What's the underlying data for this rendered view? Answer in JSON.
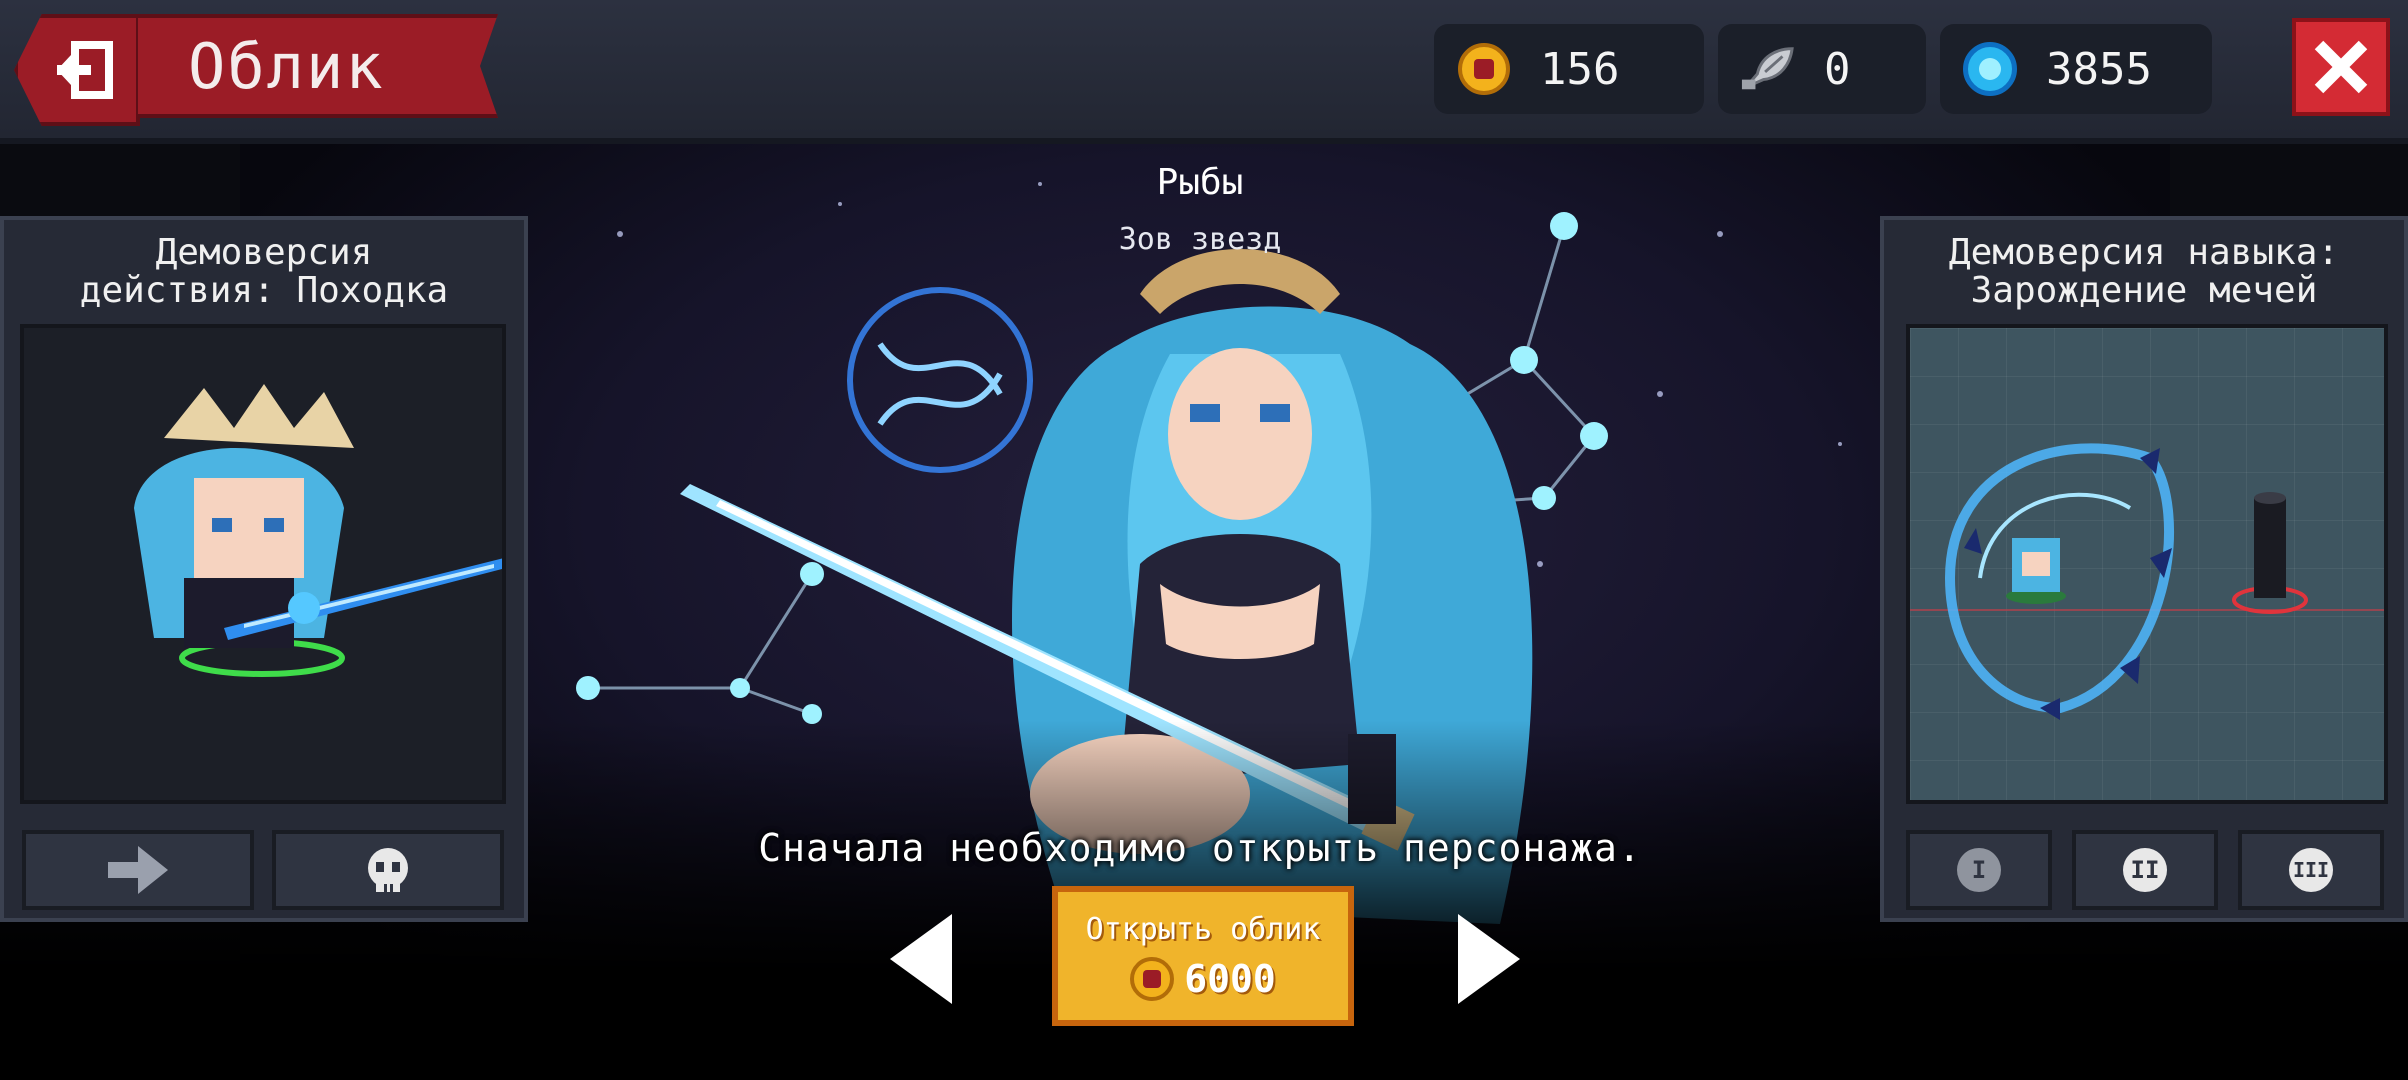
{
  "header": {
    "title": "Облик",
    "back_icon": "exit-door-icon",
    "close_icon": "close-x-icon"
  },
  "currencies": {
    "gold": {
      "icon": "gold-coin-icon",
      "value": "156"
    },
    "fish": {
      "icon": "fish-icon",
      "value": "0"
    },
    "gems": {
      "icon": "blue-gem-icon",
      "value": "3855"
    }
  },
  "character": {
    "name": "Рыбы",
    "skin_name": "Зов звезд"
  },
  "notice": "Сначала необходимо открыть персонажа.",
  "unlock": {
    "label": "Открыть облик",
    "price": "6000",
    "price_icon": "gold-coin-icon"
  },
  "left_panel": {
    "title_line1": "Демоверсия",
    "title_line2": "действия: Походка",
    "buttons": [
      {
        "icon": "arrow-right-icon"
      },
      {
        "icon": "skull-icon"
      }
    ]
  },
  "right_panel": {
    "title_line1": "Демоверсия навыка:",
    "title_line2": "Зарождение мечей",
    "buttons": [
      {
        "icon": "roman-numeral-1-icon",
        "label": "I"
      },
      {
        "icon": "roman-numeral-2-icon",
        "label": "II"
      },
      {
        "icon": "roman-numeral-3-icon",
        "label": "III"
      }
    ]
  },
  "colors": {
    "banner_red": "#9b1c26",
    "close_red": "#d42b34",
    "button_gold": "#f0b42b",
    "gem_blue": "#2ab7f0",
    "panel_bg": "#262a36"
  }
}
